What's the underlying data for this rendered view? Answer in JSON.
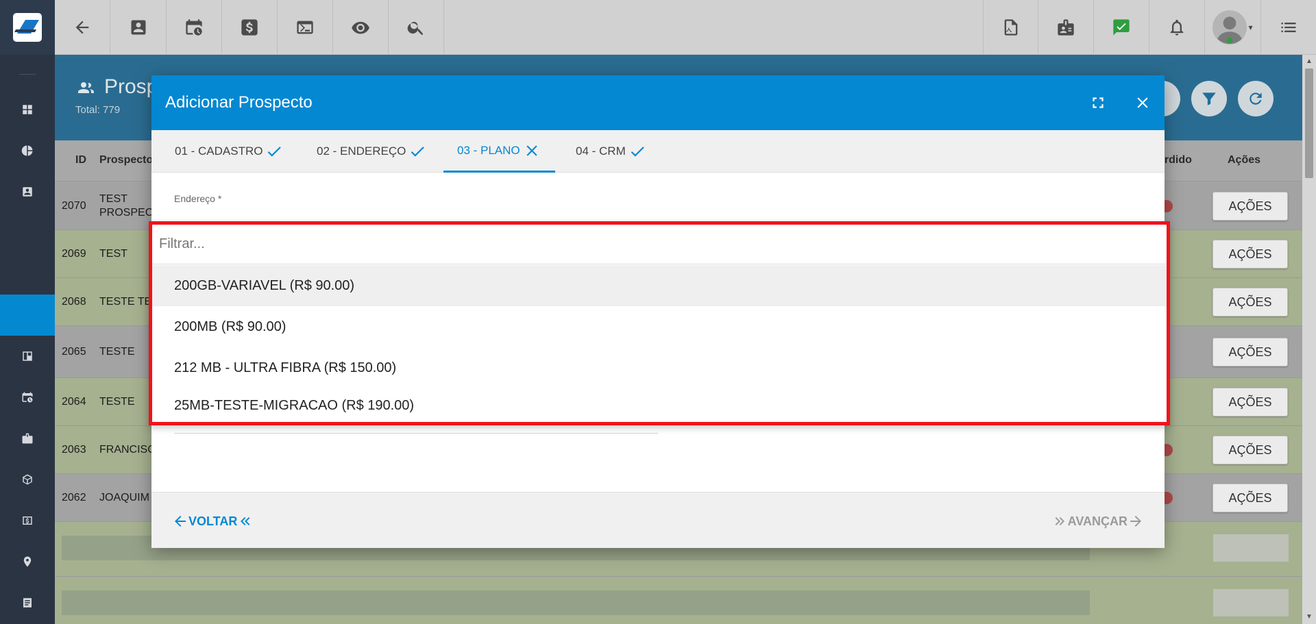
{
  "topbar": {
    "icons": [
      "back-arrow-icon",
      "contact-card-icon",
      "calendar-clock-icon",
      "dollar-icon",
      "terminal-icon",
      "eye-icon",
      "search-icon",
      "pdf-icon",
      "id-card-icon",
      "message-check-icon",
      "bell-icon",
      "user-avatar-icon",
      "menu-icon"
    ]
  },
  "page": {
    "title": "Prosp",
    "total": "Total: 779",
    "columns": {
      "id": "ID",
      "prospect": "Prospecto",
      "lost": "erdido",
      "actions": "Ações"
    },
    "rows": [
      {
        "id": "2070",
        "name": "TEST PROSPECT",
        "lost": true,
        "action": "AÇÕES"
      },
      {
        "id": "2069",
        "name": "TEST",
        "lost": false,
        "action": "AÇÕES"
      },
      {
        "id": "2068",
        "name": "TESTE TE",
        "lost": false,
        "action": "AÇÕES"
      },
      {
        "id": "2065",
        "name": "TESTE",
        "lost": false,
        "action": "AÇÕES"
      },
      {
        "id": "2064",
        "name": "TESTE",
        "lost": false,
        "action": "AÇÕES"
      },
      {
        "id": "2063",
        "name": "FRANCISC",
        "lost": true,
        "action": "AÇÕES"
      },
      {
        "id": "2062",
        "name": "JOAQUIM",
        "lost": true,
        "action": "AÇÕES"
      }
    ]
  },
  "modal": {
    "title": "Adicionar Prospecto",
    "tabs": [
      {
        "label": "01 - CADASTRO",
        "status": "check"
      },
      {
        "label": "02 - ENDEREÇO",
        "status": "check"
      },
      {
        "label": "03 - PLANO",
        "status": "error"
      },
      {
        "label": "04 - CRM",
        "status": "check"
      }
    ],
    "field_label": "Endereço *",
    "back_label": "VOLTAR",
    "next_label": "AVANÇAR"
  },
  "dropdown": {
    "filter_placeholder": "Filtrar...",
    "options": [
      "200GB-VARIAVEL (R$ 90.00)",
      "200MB (R$ 90.00)",
      "212 MB - ULTRA FIBRA (R$ 150.00)",
      "25MB-TESTE-MIGRACAO (R$ 190.00)"
    ],
    "highlight_color": "#f0131b"
  }
}
